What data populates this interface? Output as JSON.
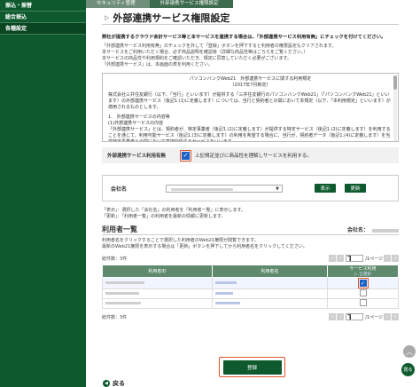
{
  "sidebar": {
    "items": [
      {
        "label": "振込・振替"
      },
      {
        "label": "総合振込"
      },
      {
        "label": "各種設定"
      }
    ]
  },
  "breadcrumbs": [
    "セキュリティ管理",
    "外部連携サービス権限設定"
  ],
  "page": {
    "title": "外部連携サービス権限設定",
    "notice": "弊社が提携するクラウド会計サービス等と本サービスを連携する場合は、「外部連携サービス利用有無」にチェックを付けてください。",
    "desc_lines": [
      "「外部連携サービス利用有無」のチェックを外して「登録」ボタンを押下すると利用者の権限設定もクリアされます。",
      "本サービスをご利用いただく場合、必ず商品説明を確認後（詳細な商品性等はこちらをご覧ください。）",
      "本サービスの商品性や利用規約をご確認いただき、規定に同意していただく必要がございます。",
      "「外部連携サービス」は、本画面の表を利用ください。"
    ]
  },
  "terms": {
    "heading": "パソコンバンクWeb21　外部連携サービスに関する利用規定",
    "date": "（2017年7月制定）",
    "paragraphs": [
      "株式会社三井住友銀行（以下、「当行」といいます）が提供する「三井住友銀行のパソコンバンクWeb21」（「パソコンバンクWeb21」といいます）の外部連携サービス（後記1.(1)に定義します）については、当行と契約者との間において本規定（以下、「本利用規定」といいます）が適用されるものとします。",
      "1.　外部連携サービスの内容等",
      "(1)外部連携サービスの内容",
      "「外部連携サービス」とは、契約者が、特定事業者（後記1.(2)に定義します）が提供する特定サービス（後記1.(2)に定義します）を利用することを通じて、利用可能サービス（後記1.(3)に定義します）の利用を希望する場合に、当行が、契約者データ（後記1.(4)に定義します）を当該特定事業者との間において直接授受するサービスをいいます。"
    ]
  },
  "agree": {
    "label": "外部連携サービス利用有無",
    "checkbox_text": "上記規定並びに商品性を理解しサービスを利用する。",
    "checked": true
  },
  "company": {
    "label": "会社名",
    "show_button": "表示",
    "update_button": "更新"
  },
  "note2_lines": [
    "「表示」：選択した「会社名」の利用者を「利用者一覧」に表示します。",
    "「更新」：「利用者一覧」の利用者を最新の情報に更新します。"
  ],
  "user_list": {
    "heading": "利用者一覧",
    "corp_label": "会社名：",
    "desc_lines": [
      "利用者名をクリックすることで選択した利用者のWeb21権限が閲覧できます。",
      "最新のWeb21権限を表示する場合は「更新」ボタンを押下してから利用者名をクリックしてください。"
    ],
    "count_top": "総件数：3件",
    "count_bottom": "総件数：3件",
    "page_top": "/1ページ",
    "page_bottom": "/1ページ",
    "page_value": "1",
    "columns": {
      "id": "利用者ID",
      "name": "利用者名",
      "use": "サービス利用",
      "use_sub": "▷ 全選択"
    },
    "rows": [
      {
        "checked": true
      },
      {
        "checked": false
      },
      {
        "checked": false
      }
    ]
  },
  "submit_label": "登録",
  "back_label": "戻る",
  "close_label": "閉る"
}
